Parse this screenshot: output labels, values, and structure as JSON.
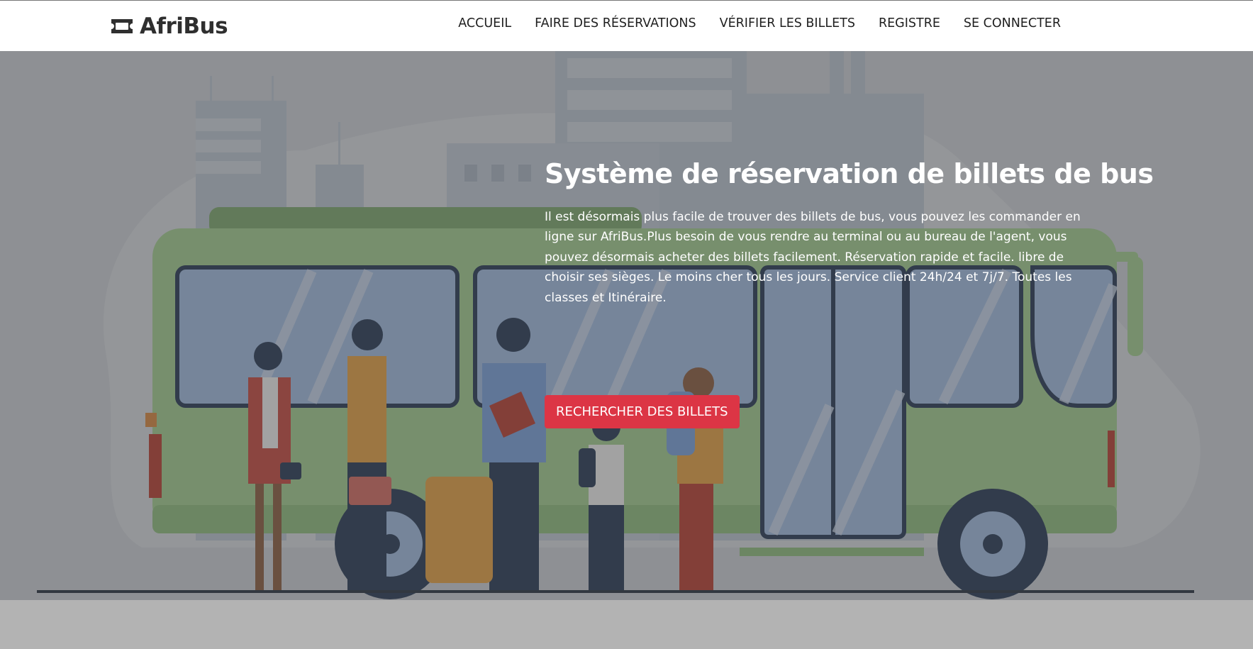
{
  "brand": {
    "name": "AfriBus",
    "icon": "ticket-icon"
  },
  "nav": {
    "items": [
      {
        "label": "ACCUEIL"
      },
      {
        "label": "FAIRE DES RÉSERVATIONS"
      },
      {
        "label": "VÉRIFIER LES BILLETS"
      },
      {
        "label": "REGISTRE"
      },
      {
        "label": "SE CONNECTER"
      }
    ]
  },
  "hero": {
    "title": "Système de réservation de billets de bus",
    "description": "Il est désormais plus facile de trouver des billets de bus, vous pouvez les commander en ligne sur AfriBus.Plus besoin de vous rendre au terminal ou au bureau de l'agent, vous pouvez désormais acheter des billets facilement. Réservation rapide et facile. libre de choisir ses sièges. Le moins cher tous les jours. Service client 24h/24 et 7j/7. Toutes les classes et Itinéraire.",
    "cta_label": "RECHERCHER DES BILLETS",
    "illustration": "bus-stop-illustration"
  },
  "colors": {
    "cta": "#dc3545",
    "nav_text": "#1f1f1f",
    "brand_text": "#2f2f2f",
    "bus_green": "#8fbf7f",
    "bus_window": "#8fb3e6"
  }
}
